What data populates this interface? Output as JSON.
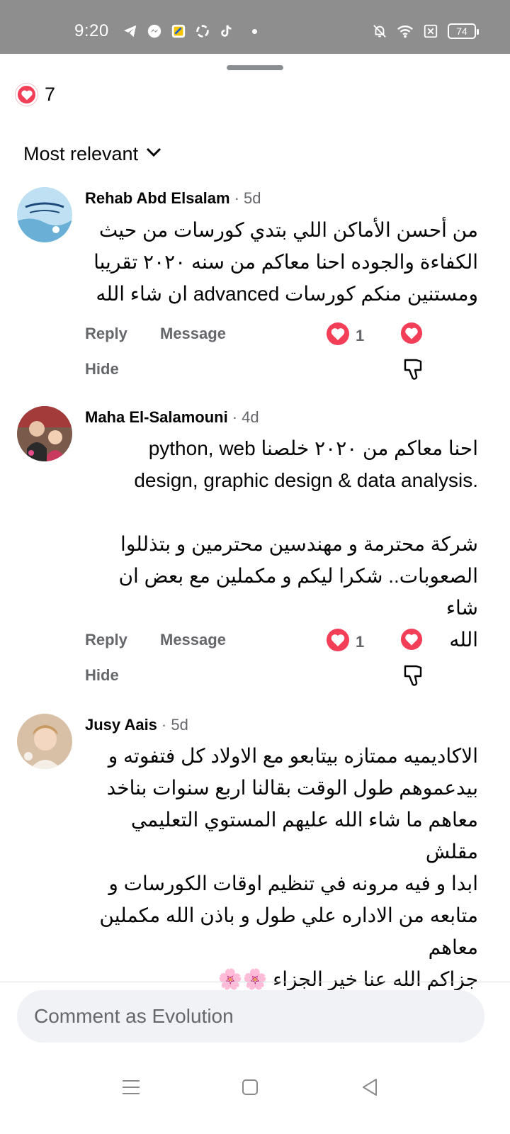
{
  "status_bar": {
    "time": "9:20",
    "battery": "74",
    "left_icons": [
      "telegram-icon",
      "messenger-icon",
      "app-icon",
      "sync-icon",
      "tiktok-icon"
    ],
    "right_icons": [
      "bell-muted-icon",
      "wifi-icon",
      "no-sim-icon",
      "battery-icon"
    ]
  },
  "reactions": {
    "count": "7",
    "type": "love"
  },
  "sort": {
    "label": "Most relevant"
  },
  "comments": [
    {
      "name": "Rehab Abd Elsalam",
      "time": "· 5d",
      "lines": [
        "من أحسن الأماكن اللي بتدي كورسات من حيث",
        "الكفاءة والجوده احنا معاكم من سنه ٢٠٢٠ تقريبا",
        "ومستنين منكم كورسات advanced ان شاء الله"
      ],
      "reply": "Reply",
      "message": "Message",
      "hide": "Hide",
      "reaction_count": "1"
    },
    {
      "name": "Maha El-Salamouni",
      "time": "· 4d",
      "lines": [
        "احنا معاكم من ٢٠٢٠ خلصنا python, web",
        "design, graphic design & data analysis.",
        "",
        "شركة محترمة و مهندسين محترمين و بتذللوا",
        "الصعوبات.. شكرا ليكم و مكملين مع بعض ان شاء",
        "الله"
      ],
      "reply": "Reply",
      "message": "Message",
      "hide": "Hide",
      "reaction_count": "1"
    },
    {
      "name": "Jusy Aais",
      "time": "· 5d",
      "lines": [
        "الاكاديميه ممتازه بيتابعو مع الاولاد كل فتفوته و",
        "بيدعموهم طول الوقت بقالنا اربع سنوات بناخد",
        "معاهم ما شاء الله عليهم المستوي التعليمي مقلش",
        "ابدا و فيه مرونه في تنظيم اوقات الكورسات و",
        "متابعه من الاداره علي طول و باذن الله مكملين",
        "معاهم",
        "جزاكم الله عنا خير الجزاء 🌸🌸"
      ]
    }
  ],
  "composer": {
    "placeholder": "Comment as Evolution"
  },
  "colors": {
    "love": "#f33e58",
    "secondary_text": "#65676b",
    "composer_bg": "#f0f2f5",
    "status_bar": "#8e8e8e"
  }
}
